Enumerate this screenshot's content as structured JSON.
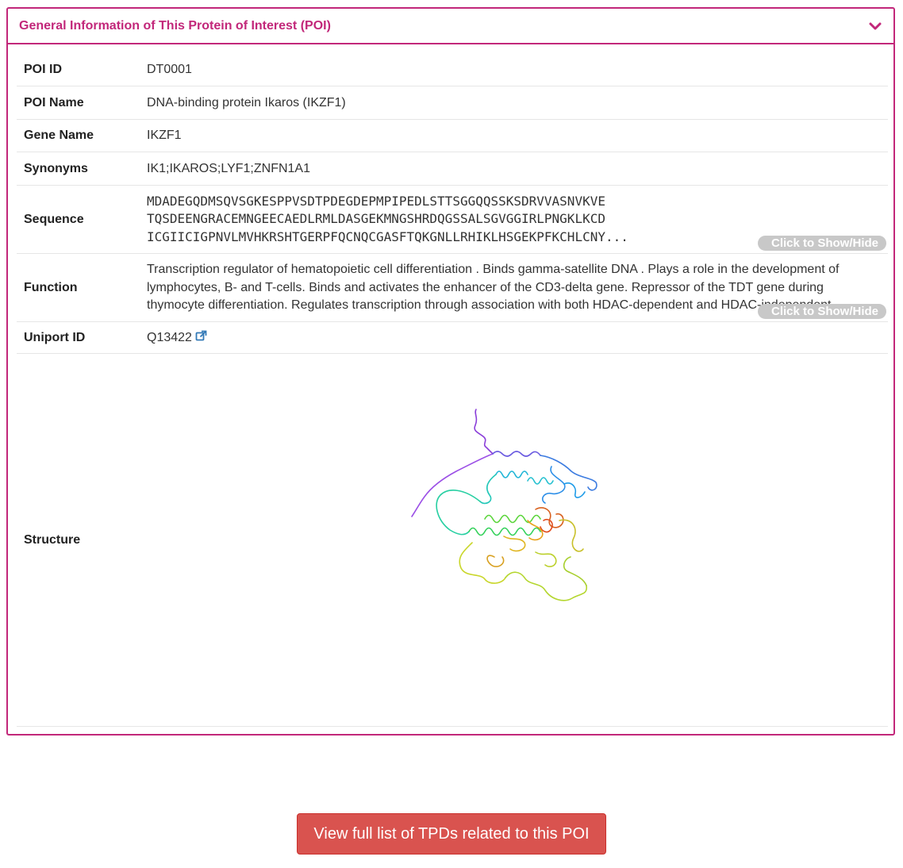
{
  "panel": {
    "title": "General Information of This Protein of Interest (POI)"
  },
  "rows": {
    "poi_id": {
      "label": "POI ID",
      "value": "DT0001"
    },
    "poi_name": {
      "label": "POI Name",
      "value": "DNA-binding protein Ikaros (IKZF1)"
    },
    "gene_name": {
      "label": "Gene Name",
      "value": "IKZF1"
    },
    "synonyms": {
      "label": "Synonyms",
      "value": "IK1;IKAROS;LYF1;ZNFN1A1"
    },
    "sequence": {
      "label": "Sequence",
      "lines": [
        "MDADEGQDMSQVSGKESPPVSDTPDEGDEPMPIPEDLSTTSGGQQSSKSDRVVASNVKVE",
        "TQSDEENGRACEMNGEECAEDLRMLDASGEKMNGSHRDQGSSALSGVGGIRLPNGKLKCD",
        "ICGIICIGPNVLMVHKRSHTGERPFQCNQCGASFTQKGNLLRHIKLHSGEKPFKCHLCNY..."
      ],
      "toggle": "Click to Show/Hide"
    },
    "function": {
      "label": "Function",
      "value": "Transcription regulator of hematopoietic cell differentiation . Binds gamma-satellite DNA . Plays a role in the development of lymphocytes, B- and T-cells. Binds and activates the enhancer of the CD3-delta gene. Repressor of the TDT gene during thymocyte differentiation. Regulates transcription through association with both HDAC-dependent and HDAC-independent complexes. Targ",
      "toggle": "Click to Show/Hide"
    },
    "uniprot": {
      "label": "Uniport ID",
      "value": "Q13422"
    },
    "structure": {
      "label": "Structure"
    }
  },
  "cta": {
    "label": "View full list of TPDs related to this POI"
  },
  "colors": {
    "accent": "#c2277a",
    "cta": "#d9534f",
    "toggle": "#c8c8c8",
    "link": "#337ab7"
  }
}
